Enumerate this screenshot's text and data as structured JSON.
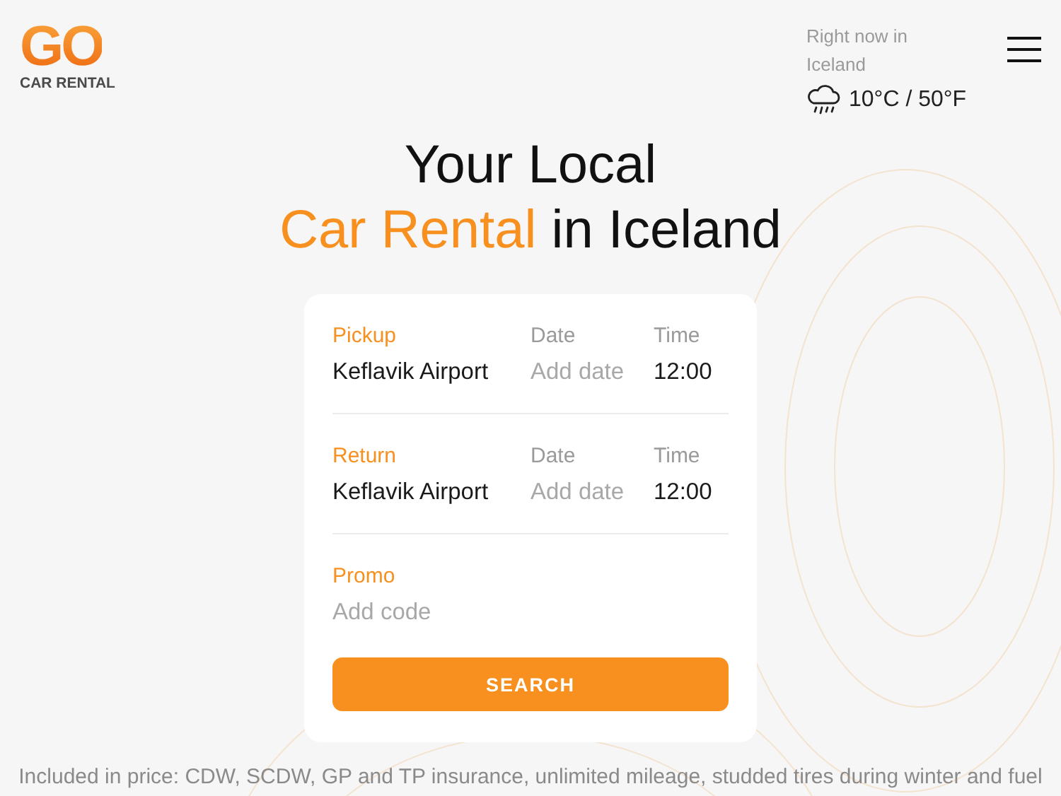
{
  "header": {
    "logo": {
      "mark": "GO",
      "subtitle": "CAR RENTAL"
    },
    "weather": {
      "label": "Right now in Iceland",
      "temperature": "10°C / 50°F"
    }
  },
  "headline": {
    "line_1": "Your Local",
    "highlight": "Car Rental",
    "rest": "in Iceland"
  },
  "booking": {
    "rows": [
      {
        "kind": "trip",
        "label": "Pickup",
        "location": "Keflavik Airport",
        "date_label": "Date",
        "date_placeholder": "Add date",
        "time_label": "Time",
        "time": "12:00"
      },
      {
        "kind": "trip",
        "label": "Return",
        "location": "Keflavik Airport",
        "date_label": "Date",
        "date_placeholder": "Add date",
        "time_label": "Time",
        "time": "12:00"
      },
      {
        "kind": "promo",
        "label": "Promo",
        "placeholder": "Add code"
      }
    ],
    "button": "SEARCH"
  },
  "footer_note": "Included in price: CDW, SCDW, GP and TP insurance, unlimited mileage, studded tires during winter and fuel"
}
